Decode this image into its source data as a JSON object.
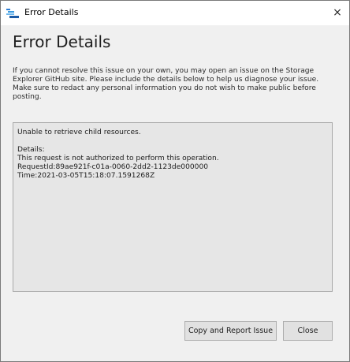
{
  "window": {
    "title": "Error Details",
    "close_glyph": "×",
    "app_icon": "storage-explorer-icon"
  },
  "heading": "Error Details",
  "intro_lines": [
    "If you cannot resolve this issue on your own, you may open an issue on the Storage",
    "Explorer GitHub site. Please include the details below to help us diagnose your issue.",
    "Make sure to redact any personal information you do not wish to make public before",
    "posting."
  ],
  "details": {
    "summary": "Unable to retrieve child resources.",
    "label": "Details:",
    "message": "This request is not authorized to perform this operation.",
    "request_id": "RequestId:89ae921f-c01a-0060-2dd2-1123de000000",
    "time": "Time:2021-03-05T15:18:07.1591268Z"
  },
  "buttons": {
    "report_label": "Copy and Report Issue",
    "close_label": "Close"
  },
  "colors": {
    "dialog_bg": "#f0f0f0",
    "details_bg": "#e6e6e6",
    "button_bg": "#e1e1e1"
  }
}
